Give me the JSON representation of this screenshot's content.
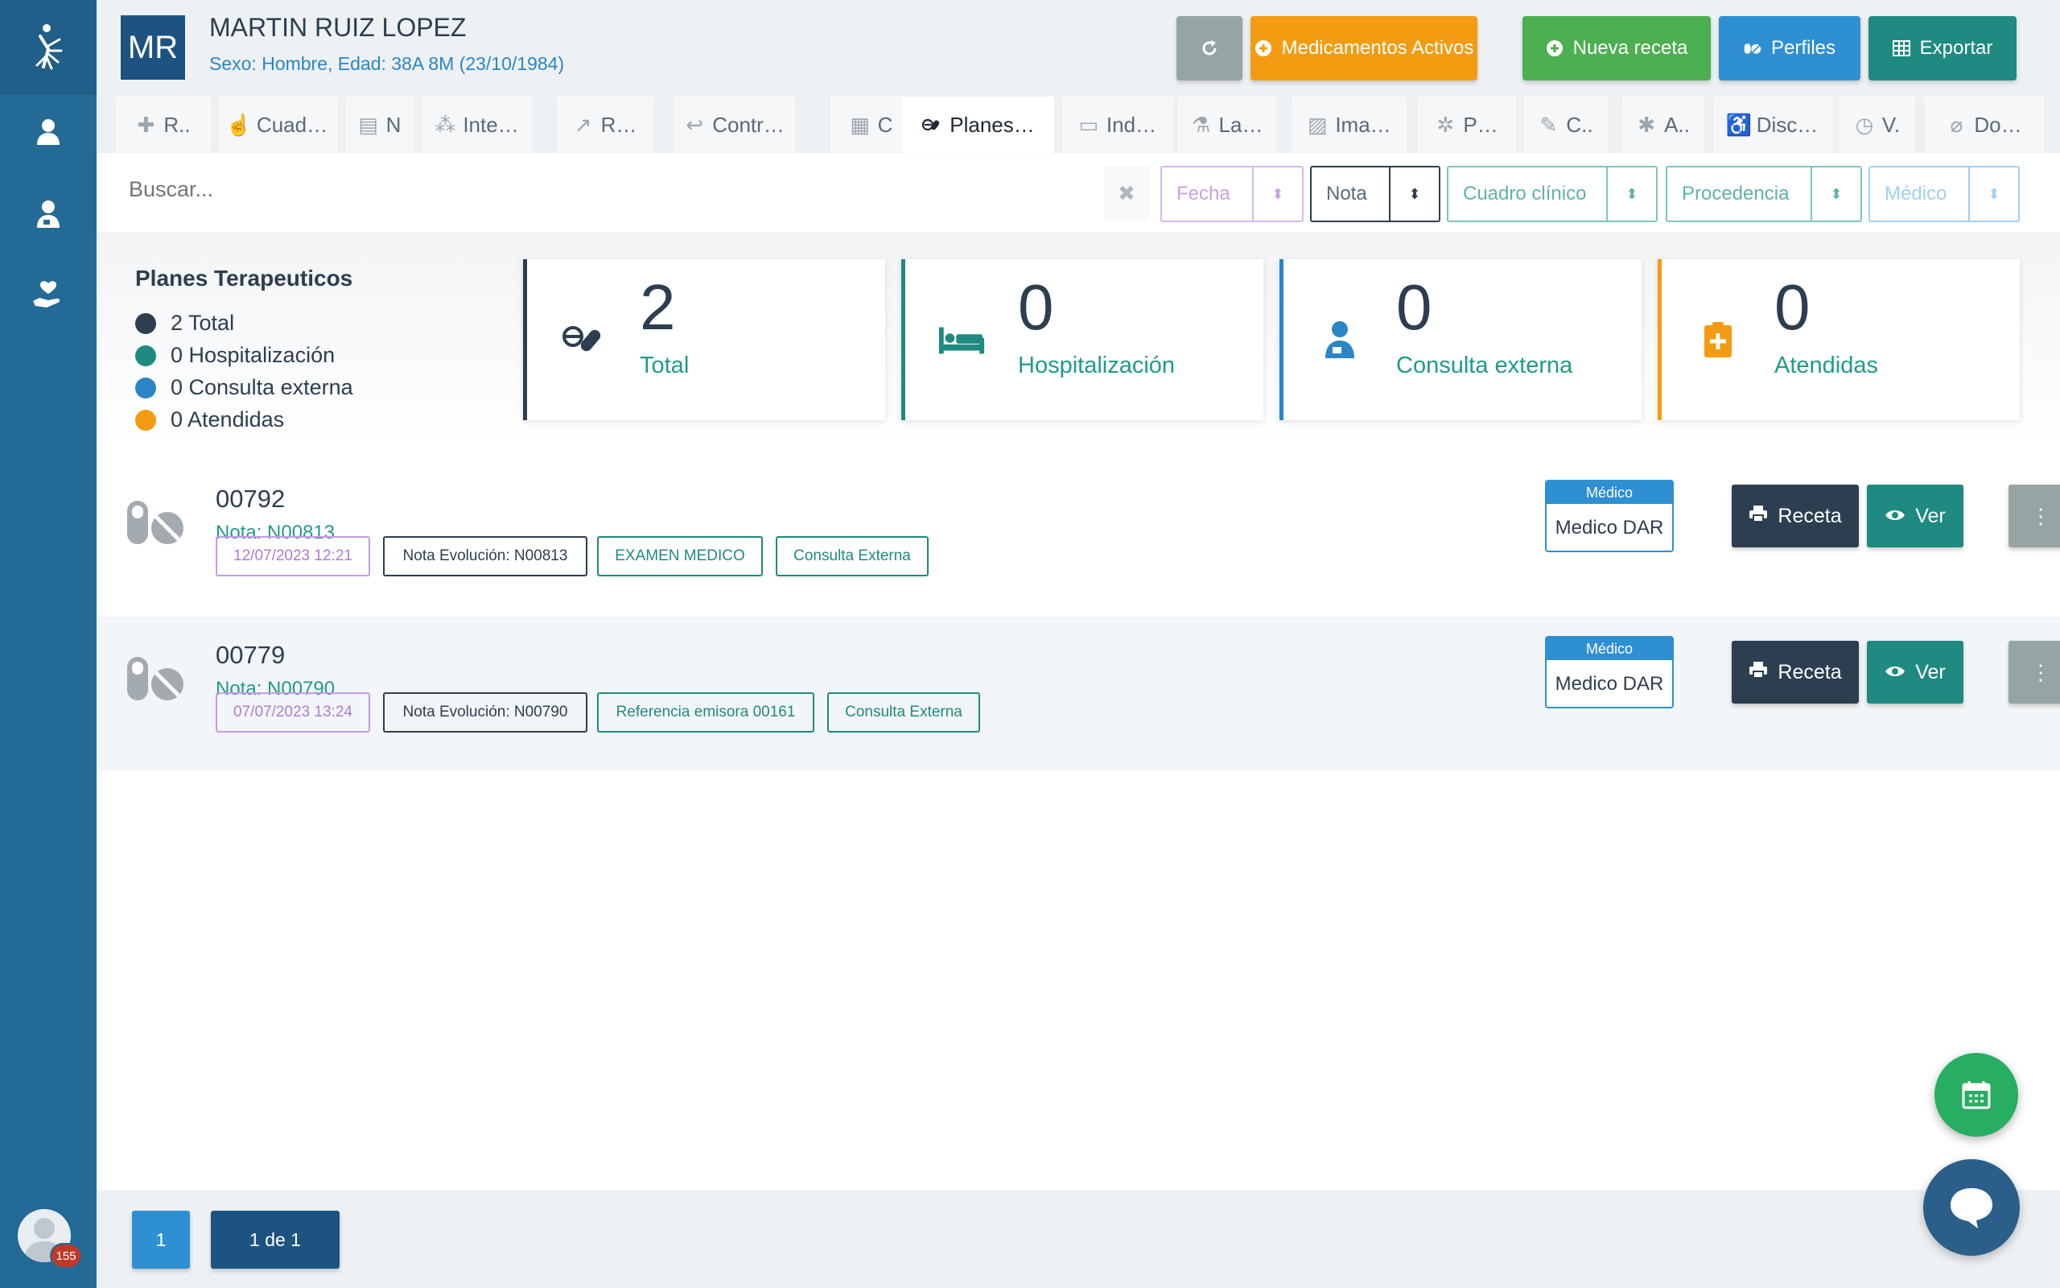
{
  "patient": {
    "initials": "MR",
    "name": "MARTIN RUIZ LOPEZ",
    "info": "Sexo: Hombre, Edad: 38A 8M (23/10/1984)"
  },
  "header_buttons": {
    "refresh_icon": "refresh-icon",
    "meds_label": "Medicamentos Activos",
    "new_rx_label": "Nueva receta",
    "profiles_label": "Perfiles",
    "export_label": "Exportar"
  },
  "tabs": [
    {
      "label": "R..",
      "icon": "hospital-icon"
    },
    {
      "label": "Cuad…",
      "icon": "hand-icon"
    },
    {
      "label": "N",
      "icon": "clipboard-icon"
    },
    {
      "label": "Inte…",
      "icon": "nodes-icon"
    },
    {
      "label": "R…",
      "icon": "share-icon"
    },
    {
      "label": "Contr…",
      "icon": "reply-icon"
    },
    {
      "label": "C",
      "icon": "calendar-icon"
    },
    {
      "label": "Planes…",
      "icon": "pills-icon"
    },
    {
      "label": "Ind…",
      "icon": "document-icon"
    },
    {
      "label": "La…",
      "icon": "microscope-icon"
    },
    {
      "label": "Ima…",
      "icon": "image-icon"
    },
    {
      "label": "P…",
      "icon": "virus-icon"
    },
    {
      "label": "C..",
      "icon": "pen-icon"
    },
    {
      "label": "A..",
      "icon": "bug-icon"
    },
    {
      "label": "Disc…",
      "icon": "wheelchair-icon"
    },
    {
      "label": "V.",
      "icon": "clock-icon"
    },
    {
      "label": "Do…",
      "icon": "paperclip-icon"
    }
  ],
  "filters": {
    "search_placeholder": "Buscar...",
    "fecha": "Fecha",
    "nota": "Nota",
    "cuadro": "Cuadro clínico",
    "procedencia": "Procedencia",
    "medico": "Médico"
  },
  "summary": {
    "title": "Planes Terapeuticos",
    "legend": [
      {
        "text": "2 Total",
        "color": "#2c3e50"
      },
      {
        "text": "0 Hospitalización",
        "color": "#1f8a80"
      },
      {
        "text": "0 Consulta externa",
        "color": "#2a86c5"
      },
      {
        "text": "0 Atendidas",
        "color": "#f39c12"
      }
    ],
    "cards": [
      {
        "value": "2",
        "label": "Total",
        "color": "#2c3e50",
        "label_color": "#1f9b8a",
        "icon": "pills-icon"
      },
      {
        "value": "0",
        "label": "Hospitalización",
        "color": "#1f8a80",
        "label_color": "#1f9b8a",
        "icon": "bed-icon"
      },
      {
        "value": "0",
        "label": "Consulta externa",
        "color": "#2a86c5",
        "label_color": "#1f9b8a",
        "icon": "doctor-icon"
      },
      {
        "value": "0",
        "label": "Atendidas",
        "color": "#f39c12",
        "label_color": "#1f9b8a",
        "icon": "clipboard-plus-icon"
      }
    ]
  },
  "records": [
    {
      "number": "00792",
      "note": "Nota: N00813",
      "tags": [
        "12/07/2023 12:21",
        "Nota Evolución: N00813",
        "EXAMEN MEDICO",
        "Consulta Externa"
      ],
      "medico_header": "Médico",
      "medico_value": "Medico DAR",
      "receta_label": "Receta",
      "ver_label": "Ver"
    },
    {
      "number": "00779",
      "note": "Nota: N00790",
      "tags": [
        "07/07/2023 13:24",
        "Nota Evolución: N00790",
        "Referencia emisora 00161",
        "Consulta Externa"
      ],
      "medico_header": "Médico",
      "medico_value": "Medico DAR",
      "receta_label": "Receta",
      "ver_label": "Ver"
    }
  ],
  "pagination": {
    "current": "1",
    "of": "1 de 1"
  },
  "user": {
    "badge": "155"
  },
  "colors": {
    "sidebar": "#246a97",
    "accent_blue": "#2e8fd3",
    "teal": "#1f8a80",
    "orange": "#f39c12",
    "green": "#4caf50",
    "dark": "#2c3e50"
  }
}
